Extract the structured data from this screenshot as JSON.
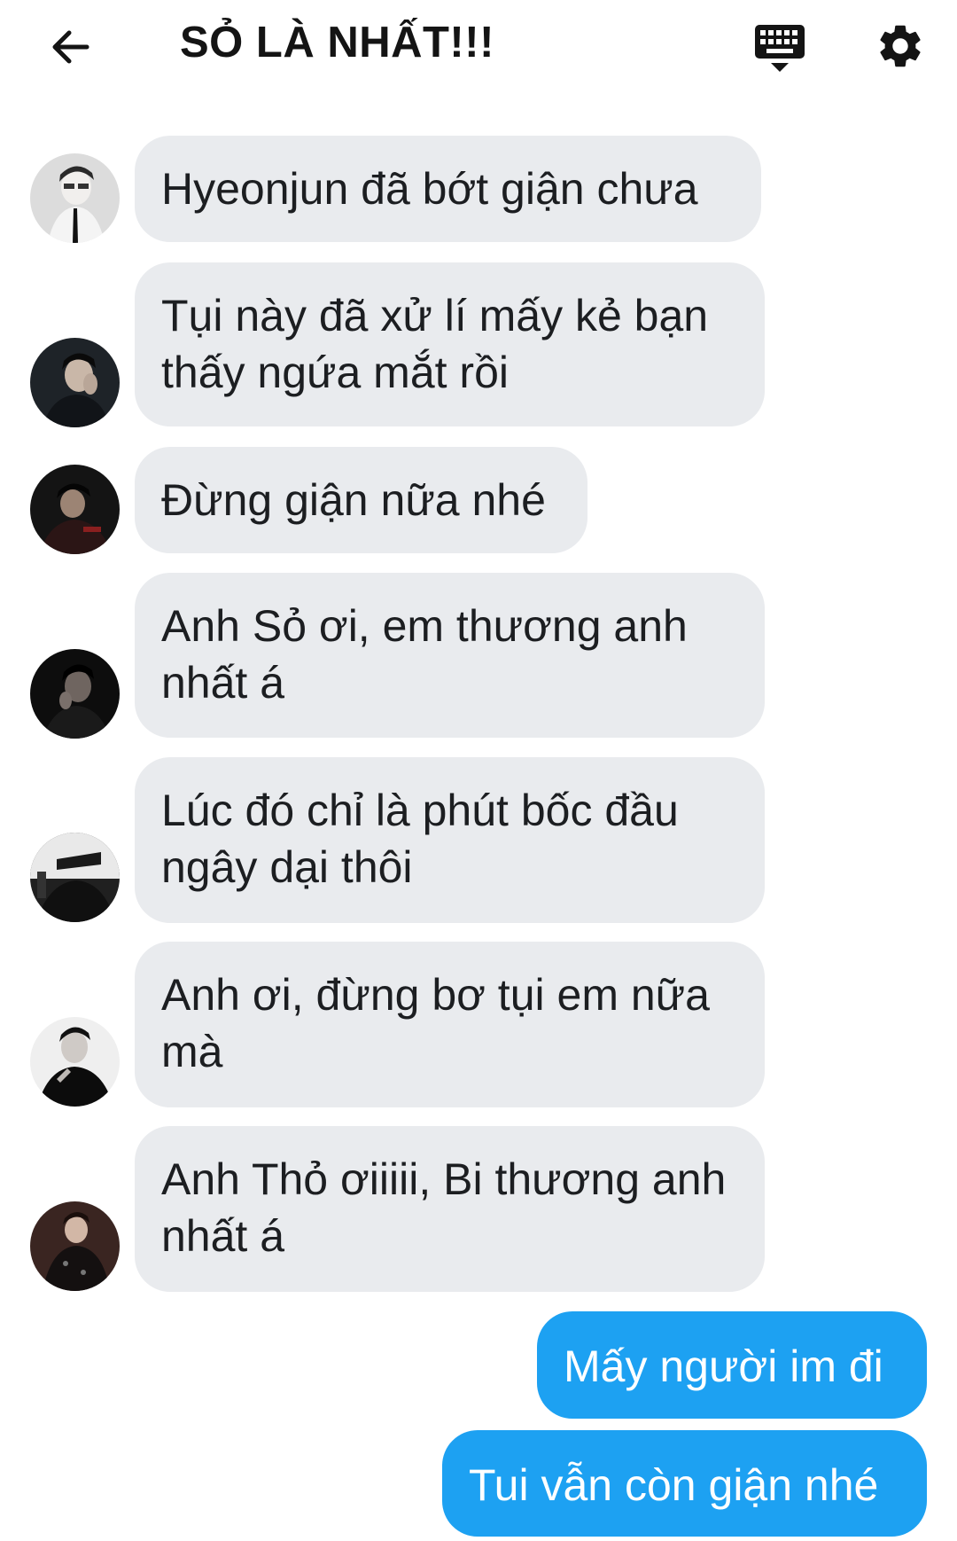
{
  "header": {
    "title": "SỎ LÀ NHẤT!!!",
    "back_icon": "arrow-left-icon",
    "keyboard_icon": "keyboard-icon",
    "settings_icon": "gear-icon"
  },
  "colors": {
    "incoming_bubble": "#e9ebee",
    "outgoing_bubble": "#1da1f2",
    "text_dark": "#1c1e21",
    "text_light": "#ffffff"
  },
  "messages": [
    {
      "sender": "other",
      "text": "Hyeonjun đã bớt giận chưa"
    },
    {
      "sender": "other",
      "text": "Tụi này đã xử lí mấy kẻ bạn thấy ngứa mắt rồi"
    },
    {
      "sender": "other",
      "text": "Đừng giận nữa nhé"
    },
    {
      "sender": "other",
      "text": "Anh Sỏ ơi, em thương anh nhất á"
    },
    {
      "sender": "other",
      "text": "Lúc đó chỉ là phút bốc đầu ngây dại thôi"
    },
    {
      "sender": "other",
      "text": "Anh ơi, đừng bơ tụi em nữa mà"
    },
    {
      "sender": "other",
      "text": "Anh Thỏ ơiiiii, Bi thương anh nhất á"
    },
    {
      "sender": "self",
      "text": "Mấy người im đi"
    },
    {
      "sender": "self",
      "text": "Tui vẫn còn giận nhé"
    }
  ]
}
